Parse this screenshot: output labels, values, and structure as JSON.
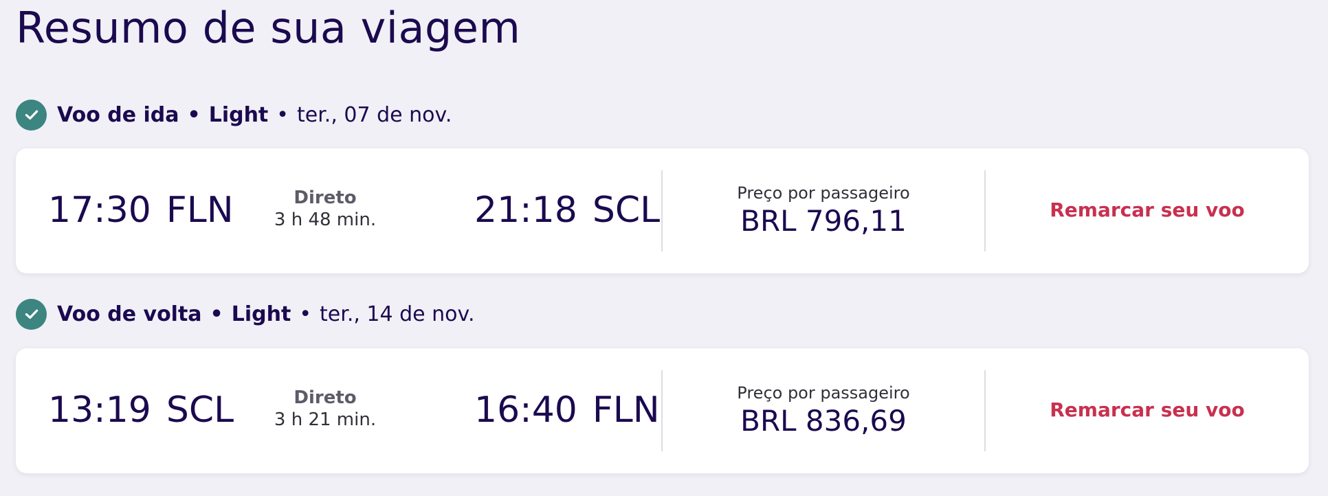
{
  "page_title": "Resumo de sua viagem",
  "colors": {
    "brand_navy": "#1b0a4f",
    "check_green": "#3c8580",
    "link_red": "#c8304f",
    "background": "#f1f0f6"
  },
  "segments": [
    {
      "label": "Voo de ida",
      "separator": "•",
      "fare": "Light",
      "date": "ter., 07 de nov.",
      "icon": "check-circle-icon",
      "departure_time": "17:30",
      "departure_code": "FLN",
      "stops": "Direto",
      "duration": "3 h 48 min.",
      "arrival_time": "21:18",
      "arrival_code": "SCL",
      "price_label": "Preço por passageiro",
      "price": "BRL 796,11",
      "action_label": "Remarcar seu voo"
    },
    {
      "label": "Voo de volta",
      "separator": "•",
      "fare": "Light",
      "date": "ter., 14 de nov.",
      "icon": "check-circle-icon",
      "departure_time": "13:19",
      "departure_code": "SCL",
      "stops": "Direto",
      "duration": "3 h 21 min.",
      "arrival_time": "16:40",
      "arrival_code": "FLN",
      "price_label": "Preço por passageiro",
      "price": "BRL 836,69",
      "action_label": "Remarcar seu voo"
    }
  ]
}
